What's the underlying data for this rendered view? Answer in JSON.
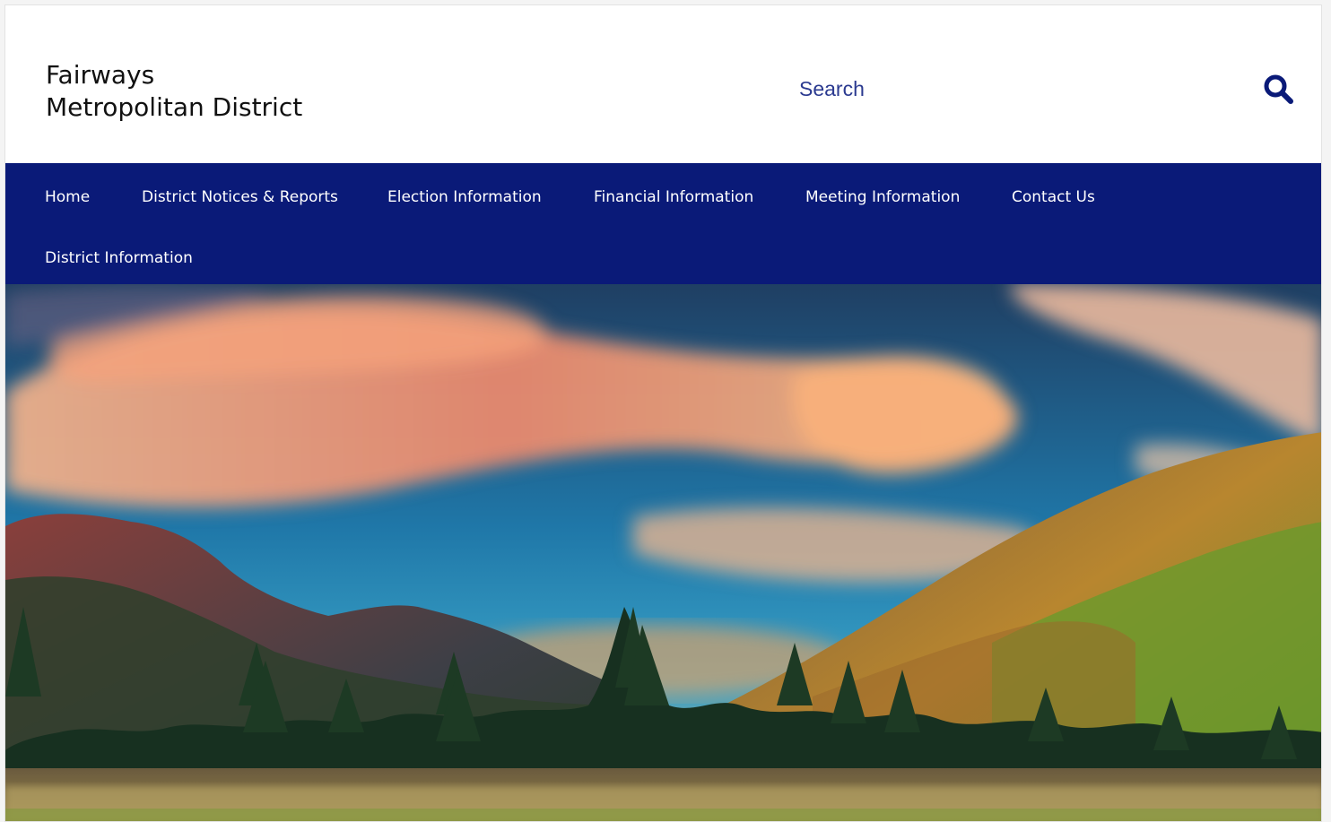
{
  "site": {
    "title_line1": "Fairways",
    "title_line2": "Metropolitan District"
  },
  "search": {
    "placeholder": "Search",
    "icon": "search-icon"
  },
  "nav": {
    "items": [
      {
        "label": "Home"
      },
      {
        "label": "District Notices & Reports"
      },
      {
        "label": "Election Information"
      },
      {
        "label": "Financial Information"
      },
      {
        "label": "Meeting Information"
      },
      {
        "label": "Contact Us"
      },
      {
        "label": "District Information"
      }
    ]
  },
  "colors": {
    "nav_background": "#0a1a78",
    "accent": "#0a1a78",
    "nav_text": "#ffffff"
  }
}
